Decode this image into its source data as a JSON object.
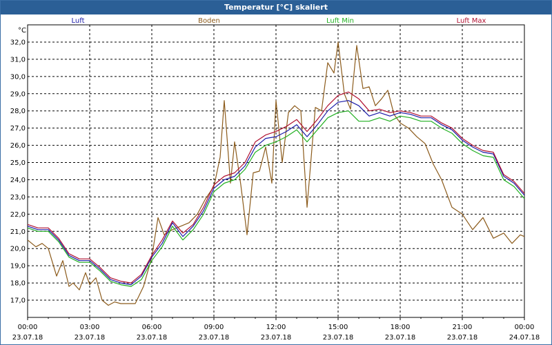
{
  "window": {
    "title": "Temperatur [°C] skaliert"
  },
  "chart_data": {
    "type": "line",
    "title": "Temperatur [°C] skaliert",
    "ylabel": "°C",
    "xlabel": "",
    "ylim": [
      16.0,
      33.0
    ],
    "xlim": [
      0,
      24
    ],
    "grid": true,
    "legend_position": "top",
    "y_ticks": [
      "17,0",
      "18,0",
      "19,0",
      "20,0",
      "21,0",
      "22,0",
      "23,0",
      "24,0",
      "25,0",
      "26,0",
      "27,0",
      "28,0",
      "29,0",
      "30,0",
      "31,0",
      "32,0"
    ],
    "x_ticks": [
      {
        "time": "00:00",
        "date": "23.07.18"
      },
      {
        "time": "03:00",
        "date": "23.07.18"
      },
      {
        "time": "06:00",
        "date": "23.07.18"
      },
      {
        "time": "09:00",
        "date": "23.07.18"
      },
      {
        "time": "12:00",
        "date": "23.07.18"
      },
      {
        "time": "15:00",
        "date": "23.07.18"
      },
      {
        "time": "18:00",
        "date": "23.07.18"
      },
      {
        "time": "21:00",
        "date": "23.07.18"
      },
      {
        "time": "00:00",
        "date": "24.07.18"
      }
    ],
    "series": [
      {
        "name": "Luft",
        "color": "#1a1aa8",
        "x": [
          0,
          0.5,
          1,
          1.5,
          2,
          2.5,
          3,
          3.5,
          4,
          4.5,
          5,
          5.5,
          6,
          6.5,
          7,
          7.5,
          8,
          8.5,
          9,
          9.5,
          10,
          10.5,
          11,
          11.5,
          12,
          12.5,
          13,
          13.5,
          14,
          14.5,
          15,
          15.5,
          16,
          16.5,
          17,
          17.5,
          18,
          18.5,
          19,
          19.5,
          20,
          20.5,
          21,
          21.5,
          22,
          22.5,
          23,
          23.5,
          24
        ],
        "values": [
          21.3,
          21.1,
          21.1,
          20.5,
          19.6,
          19.3,
          19.3,
          18.8,
          18.2,
          18.0,
          17.9,
          18.4,
          19.5,
          20.3,
          21.5,
          20.7,
          21.3,
          22.2,
          23.5,
          24.0,
          24.2,
          24.8,
          25.9,
          26.4,
          26.5,
          26.8,
          27.2,
          26.5,
          27.2,
          28.0,
          28.5,
          28.6,
          28.3,
          27.7,
          27.9,
          27.7,
          27.9,
          27.8,
          27.6,
          27.6,
          27.2,
          26.9,
          26.3,
          25.9,
          25.6,
          25.5,
          24.2,
          23.8,
          23.1
        ]
      },
      {
        "name": "Boden",
        "color": "#8b5a1a",
        "x": [
          0,
          0.4,
          0.7,
          1,
          1.4,
          1.7,
          2,
          2.2,
          2.5,
          2.8,
          3,
          3.3,
          3.6,
          3.9,
          4.2,
          4.5,
          4.8,
          5.2,
          5.6,
          6,
          6.3,
          6.6,
          7,
          7.4,
          7.8,
          8.2,
          8.6,
          9,
          9.3,
          9.5,
          9.8,
          10,
          10.3,
          10.6,
          10.9,
          11.2,
          11.5,
          11.8,
          12,
          12.3,
          12.6,
          12.9,
          13.2,
          13.5,
          13.9,
          14.2,
          14.5,
          14.8,
          15,
          15.3,
          15.6,
          15.9,
          16.2,
          16.5,
          16.8,
          17.1,
          17.4,
          17.7,
          18,
          18.4,
          18.8,
          19.2,
          19.6,
          20,
          20.5,
          21,
          21.5,
          22,
          22.5,
          23,
          23.4,
          23.8,
          24
        ],
        "values": [
          20.5,
          20.1,
          20.3,
          20.0,
          18.4,
          19.3,
          17.8,
          18.0,
          17.6,
          18.6,
          17.9,
          18.3,
          17.0,
          16.7,
          16.9,
          16.8,
          16.8,
          16.8,
          17.8,
          19.5,
          21.8,
          20.8,
          21.1,
          21.3,
          21.5,
          22.0,
          22.9,
          23.6,
          25.3,
          28.6,
          23.8,
          26.2,
          23.7,
          20.8,
          24.4,
          24.5,
          25.9,
          23.8,
          28.6,
          25.0,
          27.9,
          28.3,
          28.0,
          22.4,
          28.2,
          28.0,
          30.8,
          30.2,
          32.0,
          29.0,
          28.1,
          31.8,
          29.3,
          29.4,
          28.3,
          28.7,
          29.2,
          27.8,
          27.3,
          27.0,
          26.5,
          26.1,
          24.9,
          24.0,
          22.4,
          22.0,
          21.1,
          21.8,
          20.6,
          20.9,
          20.3,
          20.8,
          20.7
        ]
      },
      {
        "name": "Luft Min",
        "color": "#20b020",
        "x": [
          0,
          0.5,
          1,
          1.5,
          2,
          2.5,
          3,
          3.5,
          4,
          4.5,
          5,
          5.5,
          6,
          6.5,
          7,
          7.5,
          8,
          8.5,
          9,
          9.5,
          10,
          10.5,
          11,
          11.5,
          12,
          12.5,
          13,
          13.5,
          14,
          14.5,
          15,
          15.5,
          16,
          16.5,
          17,
          17.5,
          18,
          18.5,
          19,
          19.5,
          20,
          20.5,
          21,
          21.5,
          22,
          22.5,
          23,
          23.5,
          24
        ],
        "values": [
          21.2,
          21.0,
          21.0,
          20.4,
          19.5,
          19.2,
          19.2,
          18.7,
          18.1,
          17.9,
          17.8,
          18.2,
          19.3,
          20.1,
          21.3,
          20.5,
          21.1,
          22.0,
          23.3,
          23.8,
          24.0,
          24.6,
          25.6,
          26.0,
          26.2,
          26.5,
          26.9,
          26.2,
          26.9,
          27.6,
          27.9,
          28.0,
          27.4,
          27.4,
          27.6,
          27.4,
          27.7,
          27.6,
          27.4,
          27.4,
          27.0,
          26.7,
          26.1,
          25.7,
          25.4,
          25.3,
          24.0,
          23.6,
          22.9
        ]
      },
      {
        "name": "Luft Max",
        "color": "#b01030",
        "x": [
          0,
          0.5,
          1,
          1.5,
          2,
          2.5,
          3,
          3.5,
          4,
          4.5,
          5,
          5.5,
          6,
          6.5,
          7,
          7.5,
          8,
          8.5,
          9,
          9.5,
          10,
          10.5,
          11,
          11.5,
          12,
          12.5,
          13,
          13.5,
          14,
          14.5,
          15,
          15.5,
          16,
          16.5,
          17,
          17.5,
          18,
          18.5,
          19,
          19.5,
          20,
          20.5,
          21,
          21.5,
          22,
          22.5,
          23,
          23.5,
          24
        ],
        "values": [
          21.4,
          21.2,
          21.2,
          20.6,
          19.7,
          19.4,
          19.4,
          18.9,
          18.3,
          18.1,
          18.0,
          18.5,
          19.6,
          20.5,
          21.6,
          20.9,
          21.4,
          22.4,
          23.7,
          24.2,
          24.4,
          25.0,
          26.2,
          26.6,
          26.8,
          27.1,
          27.5,
          26.8,
          27.5,
          28.3,
          28.9,
          29.1,
          28.7,
          28.0,
          28.1,
          27.9,
          28.0,
          27.9,
          27.7,
          27.7,
          27.3,
          27.0,
          26.4,
          26.0,
          25.7,
          25.6,
          24.3,
          23.9,
          23.2
        ]
      }
    ]
  }
}
